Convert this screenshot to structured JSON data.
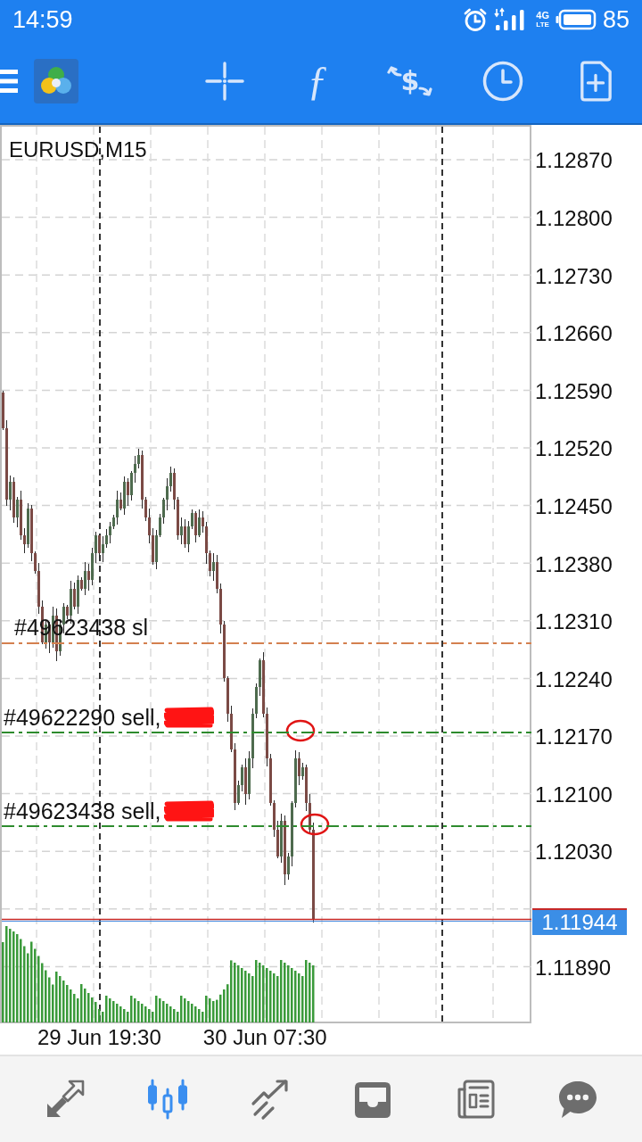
{
  "status_bar": {
    "time": "14:59",
    "network": "4G",
    "network_sub": "LTE",
    "battery": "85"
  },
  "toolbar": {
    "items": [
      {
        "kind": "crosshair"
      },
      {
        "kind": "function",
        "text": "ƒ"
      },
      {
        "kind": "trade",
        "text": "$"
      },
      {
        "kind": "clock"
      },
      {
        "kind": "new-document"
      }
    ]
  },
  "chart": {
    "symbol": "EURUSD,M15",
    "price_labels": [
      "1.12870",
      "1.12800",
      "1.12730",
      "1.12660",
      "1.12590",
      "1.12520",
      "1.12450",
      "1.12380",
      "1.12310",
      "1.12240",
      "1.12170",
      "1.12100",
      "1.12030",
      "1.11890"
    ],
    "current_price": "1.11944",
    "time_labels": [
      "29 Jun 19:30",
      "30 Jun 07:30"
    ],
    "orders": [
      {
        "label": "#49623438 sl",
        "color": "#d4804f",
        "redacted": false,
        "circled": false
      },
      {
        "label": "#49622290 sell,",
        "color": "#2e8b2e",
        "redacted": true,
        "circled": true
      },
      {
        "label": "#49623438 sell,",
        "color": "#2e8b2e",
        "redacted": true,
        "circled": true
      }
    ]
  },
  "bottom_nav": [
    {
      "kind": "quotes",
      "selected": false
    },
    {
      "kind": "chart",
      "selected": true
    },
    {
      "kind": "trade",
      "selected": false
    },
    {
      "kind": "history",
      "selected": false
    },
    {
      "kind": "news",
      "selected": false
    },
    {
      "kind": "chat",
      "selected": false
    }
  ]
}
